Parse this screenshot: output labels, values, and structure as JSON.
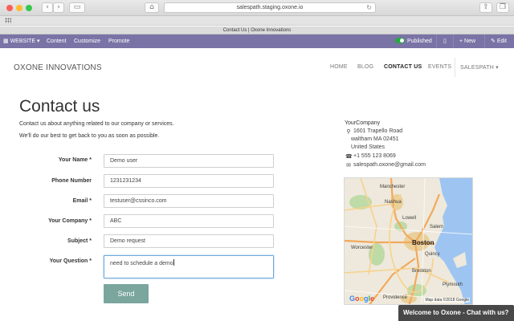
{
  "browser": {
    "url": "salespath.staging.oxone.io",
    "tab_title": "Contact Us | Oxone Innovations"
  },
  "admin_bar": {
    "website": "WEBSITE ▾",
    "content": "Content",
    "customize": "Customize",
    "promote": "Promote",
    "published": "Published",
    "new": "New",
    "edit": "Edit",
    "accent_color": "#7a73a6"
  },
  "site": {
    "brand": "OXONE INNOVATIONS",
    "nav": [
      "HOME",
      "BLOG",
      "CONTACT US",
      "EVENTS",
      "SALESPATH ▾"
    ],
    "active_nav": "CONTACT US"
  },
  "page": {
    "title": "Contact us",
    "intro1": "Contact us about anything related to our company or services.",
    "intro2": "We'll do our best to get back to you as soon as possible."
  },
  "form": {
    "fields": [
      {
        "label": "Your Name *",
        "value": "Demo user"
      },
      {
        "label": "Phone Number",
        "value": "1231231234"
      },
      {
        "label": "Email *",
        "value": "testuser@cssinco.com"
      },
      {
        "label": "Your Company *",
        "value": "ABC"
      },
      {
        "label": "Subject *",
        "value": "Demo request"
      },
      {
        "label": "Your Question *",
        "value": "need to schedule a demo"
      }
    ],
    "submit": "Send",
    "submit_color": "#7aa69e"
  },
  "company": {
    "name": "YourCompany",
    "address1": "1601 Trapello Road",
    "address2": "waltham MA 02451",
    "country": "United States",
    "phone": "+1 555 123 8069",
    "email": "salespath.oxone@gmail.com"
  },
  "map": {
    "labels": [
      "Manchester",
      "Nashua",
      "Salem",
      "Lowell",
      "Boston",
      "Brockton",
      "Plymouth",
      "Providence",
      "Worcester",
      "Quincy"
    ],
    "logo": "Google",
    "credit": "Map data ©2018 Google"
  },
  "chat": {
    "text": "Welcome to Oxone - Chat with us?"
  }
}
